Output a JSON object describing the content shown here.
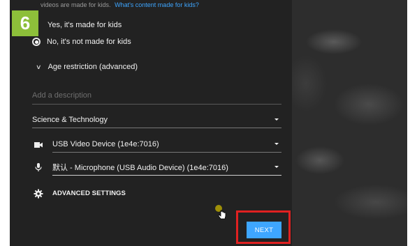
{
  "step": {
    "number": "6"
  },
  "audience": {
    "cut_text": "videos are made for kids.",
    "cut_link": "What's content made for kids?",
    "options": [
      {
        "label": "Yes, it's made for kids",
        "selected": false
      },
      {
        "label": "No, it's not made for kids",
        "selected": true
      }
    ],
    "age_restriction_label": "Age restriction (advanced)"
  },
  "description": {
    "placeholder": "Add a description"
  },
  "category": {
    "value": "Science & Technology"
  },
  "camera": {
    "icon": "videocam-icon",
    "value": "USB Video Device (1e4e:7016)"
  },
  "microphone": {
    "icon": "microphone-icon",
    "value": "默认 - Microphone (USB Audio Device) (1e4e:7016)"
  },
  "advanced": {
    "icon": "gear-icon",
    "label": "ADVANCED SETTINGS"
  },
  "next_button": {
    "label": "NEXT",
    "color": "#3ea6ff"
  },
  "colors": {
    "highlight": "#e02121",
    "badge": "#8dbf3a",
    "panel": "#222222"
  }
}
